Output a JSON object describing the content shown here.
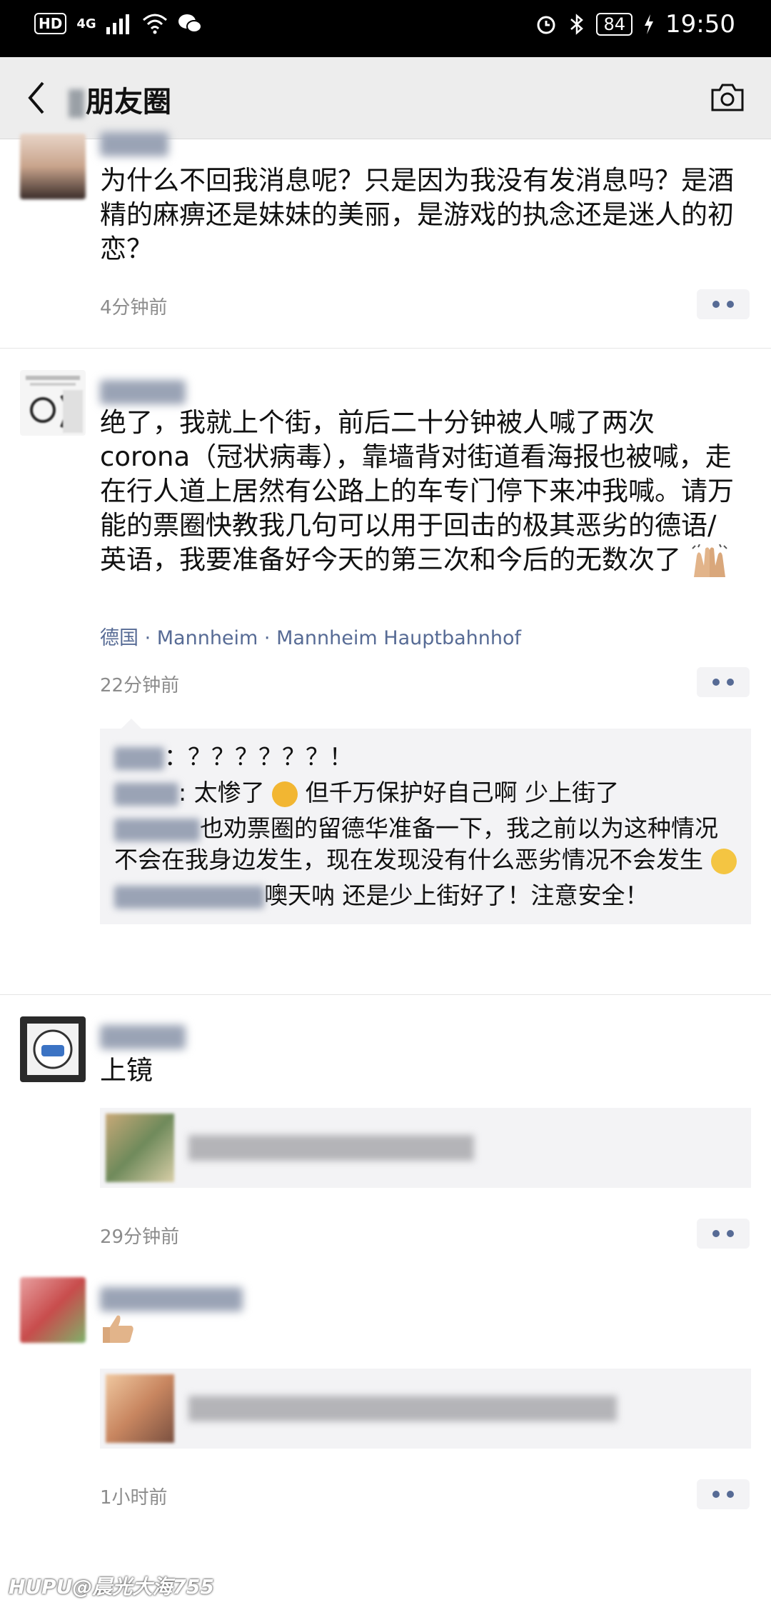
{
  "status_bar": {
    "hd_label": "HD",
    "network_label": "4G",
    "battery": "84",
    "time": "19:50"
  },
  "nav": {
    "title": "朋友圈"
  },
  "posts": [
    {
      "text": "为什么不回我消息呢？只是因为我没有发消息吗？是酒精的麻痹还是妹妹的美丽，是游戏的执念还是迷人的初恋？",
      "time": "4分钟前"
    },
    {
      "text": "绝了，我就上个街，前后二十分钟被人喊了两次corona（冠状病毒），靠墙背对街道看海报也被喊，走在行人道上居然有公路上的车专门停下来冲我喊。请万能的票圈快教我几句可以用于回击的极其恶劣的德语/英语，我要准备好今天的第三次和今后的无数次了",
      "location": "德国 · Mannheim · Mannheim Hauptbahnhof",
      "time": "22分钟前",
      "comments": [
        {
          "text": "：？？？？？？！"
        },
        {
          "text": ": 太惨了",
          "text2": "但千万保护好自己啊 少上街了"
        },
        {
          "text": "也劝票圈的留德华准备一下，我之前以为这种情况不会在我身边发生，现在发现没有什么恶劣情况不会发生"
        },
        {
          "text": "噢天呐 还是少上街好了！注意安全！"
        }
      ]
    },
    {
      "text": "上镜",
      "time": "29分钟前"
    },
    {
      "time": "1小时前"
    }
  ],
  "watermark": "HUPU@晨光大海755",
  "colors": {
    "status_bg": "#000000",
    "nav_bg": "#ededed",
    "link_blue": "#576b95",
    "time_gray": "#8c8c8c",
    "comment_bg": "#f3f3f5"
  }
}
